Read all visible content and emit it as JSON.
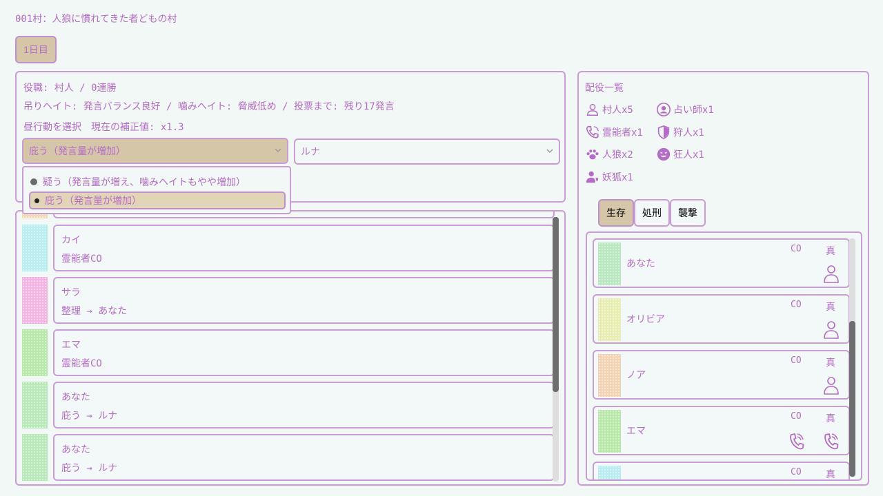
{
  "header": {
    "title": "001村：人狼に慣れてきた者どもの村",
    "day_button": "1日目"
  },
  "status": {
    "role_line": "役職: 村人 / 0連勝",
    "hate_line": "吊りヘイト: 発言バランス良好 / 噛みヘイト: 脅威低め / 投票まで: 残り17発言",
    "action_line": "昼行動を選択　現在の補正値: x1.3",
    "action_select": "庇う（発言量が増加）",
    "target_select": "ルナ",
    "dropdown_options": [
      {
        "label": "疑う（発言量が増え、噛みヘイトもやや増加）"
      },
      {
        "label": "庇う（発言量が増加）"
      }
    ]
  },
  "log": [
    {
      "name": "カイ",
      "message": "霊能者CO",
      "color": "#b8ecef"
    },
    {
      "name": "サラ",
      "message": "整理 → あなた",
      "color": "#f4b4e2"
    },
    {
      "name": "エマ",
      "message": "霊能者CO",
      "color": "#b8e8a8"
    },
    {
      "name": "あなた",
      "message": "庇う → ルナ",
      "color": "#b8e8b8"
    },
    {
      "name": "あなた",
      "message": "庇う → ルナ",
      "color": "#b8e8b8"
    }
  ],
  "roles": {
    "title": "配役一覧",
    "items": [
      {
        "icon": "villager-icon",
        "label": "村人x5"
      },
      {
        "icon": "seer-icon",
        "label": "占い師x1"
      },
      {
        "icon": "medium-icon",
        "label": "霊能者x1"
      },
      {
        "icon": "hunter-icon",
        "label": "狩人x1"
      },
      {
        "icon": "werewolf-icon",
        "label": "人狼x2"
      },
      {
        "icon": "madman-icon",
        "label": "狂人x1"
      },
      {
        "icon": "fox-icon",
        "label": "妖狐x1"
      }
    ]
  },
  "tabs": [
    {
      "label": "生存",
      "active": true
    },
    {
      "label": "処刑",
      "active": false
    },
    {
      "label": "襲撃",
      "active": false
    }
  ],
  "players": [
    {
      "name": "あなた",
      "co_label": "CO",
      "true_label": "真",
      "color": "#b8e8c0",
      "co_icon": "",
      "true_icon": "villager-icon"
    },
    {
      "name": "オリビア",
      "co_label": "CO",
      "true_label": "真",
      "color": "#e8eeb0",
      "co_icon": "",
      "true_icon": "villager-icon"
    },
    {
      "name": "ノア",
      "co_label": "CO",
      "true_label": "真",
      "color": "#f2d4b4",
      "co_icon": "",
      "true_icon": "villager-icon"
    },
    {
      "name": "エマ",
      "co_label": "CO",
      "true_label": "真",
      "color": "#b8e8a8",
      "co_icon": "medium-icon",
      "true_icon": "medium-icon"
    },
    {
      "name": "",
      "co_label": "CO",
      "true_label": "真",
      "color": "#b8ecef",
      "co_icon": "",
      "true_icon": ""
    }
  ],
  "colors": {
    "accent": "#b46cc8",
    "border": "#c99bd8",
    "active_bg": "#d6c6a8",
    "background": "#f1f8f6"
  }
}
